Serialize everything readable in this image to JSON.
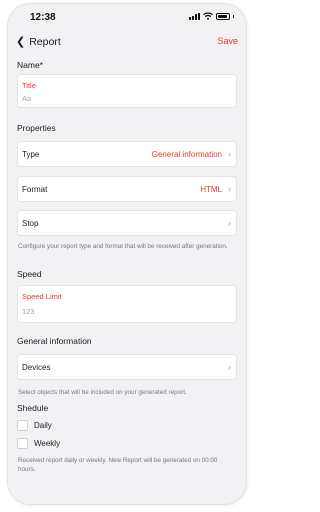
{
  "status_bar": {
    "time": "12:38"
  },
  "nav": {
    "back_label": "Report",
    "save_label": "Save"
  },
  "name_section": {
    "label": "Name*",
    "field_label": "Title",
    "placeholder": "Aa"
  },
  "properties_section": {
    "label": "Properties",
    "rows": [
      {
        "label": "Type",
        "value": "General information"
      },
      {
        "label": "Format",
        "value": "HTML"
      },
      {
        "label": "Stop",
        "value": ""
      }
    ],
    "help": "Configure your report type and format that will be received after generation."
  },
  "speed_section": {
    "label": "Speed",
    "field_label": "Speed Limit",
    "placeholder": "123"
  },
  "general_section": {
    "label": "General information",
    "row_label": "Devices",
    "help": "Select objects that will be included on your generated report."
  },
  "schedule_section": {
    "label": "Shedule",
    "options": [
      {
        "label": "Daily",
        "checked": false
      },
      {
        "label": "Weekly",
        "checked": false
      }
    ],
    "help": "Received report daily or weekly. New Report will be generated on 00:00 hours."
  },
  "colors": {
    "accent": "#e53935",
    "background": "#f2f2f4"
  },
  "icons": [
    "chevron-left-icon",
    "chevron-right-icon",
    "signal-icon",
    "wifi-icon",
    "battery-icon"
  ]
}
